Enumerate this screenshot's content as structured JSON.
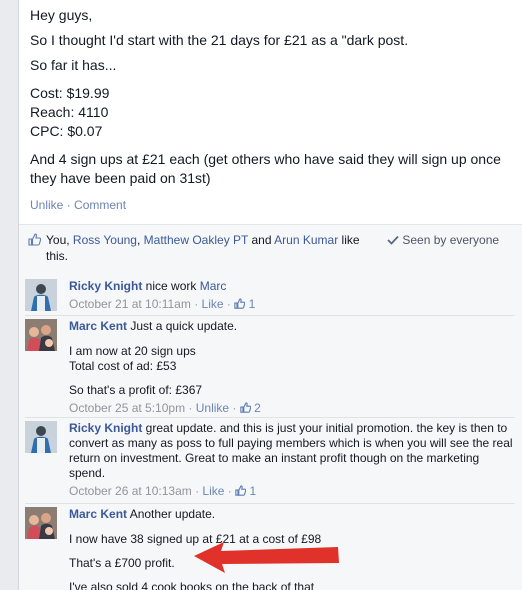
{
  "post": {
    "lines": [
      "Hey guys,",
      "So I thought I'd start with the 21 days for £21 as a \"dark post.",
      "So far it has...",
      "Cost: $19.99",
      "Reach: 4110",
      "CPC: $0.07",
      "And 4 sign ups at £21 each (get others who have said they will sign up once they have been paid on 31st)"
    ]
  },
  "actions": {
    "unlike": "Unlike",
    "separator": "·",
    "comment": "Comment"
  },
  "likes": {
    "you": "You, ",
    "person1": "Ross Young",
    "comma1": ", ",
    "person2": "Matthew Oakley PT",
    "and": " and ",
    "person3": "Arun Kumar",
    "suffix": " like this.",
    "seen_by": "Seen by everyone"
  },
  "comments": [
    {
      "author": "Ricky Knight",
      "text": " nice work ",
      "mention": "Marc",
      "timestamp": "October 21 at 10:11am",
      "like_label": "Like",
      "like_count": "1"
    },
    {
      "author": "Marc Kent",
      "text": " Just a quick update.",
      "para1": "I am now at 20 sign ups",
      "para2": "Total cost of ad: £53",
      "para3": "So that's a profit of: £367",
      "timestamp": "October 25 at 5:10pm",
      "like_label": "Unlike",
      "like_count": "2"
    },
    {
      "author": "Ricky Knight",
      "text": " great update. and this is just your initial promotion. the key is then to convert as many as poss to full paying members which is when you will see the real return on investment. Great to make an instant profit though on the marketing spend.",
      "timestamp": "October 26 at 10:13am",
      "like_label": "Like",
      "like_count": "1"
    },
    {
      "author": "Marc Kent",
      "text": " Another update.",
      "para1": "I now have 38 signed up at £21 at a cost of £98",
      "para2": "That's a £700 profit.",
      "para3": "I've also sold 4 cook books on the back of that"
    }
  ],
  "colors": {
    "link": "#3b5998",
    "arrow": "#e0322b",
    "background": "#f6f7f8"
  },
  "icons": [
    "thumbs-up-icon",
    "checkmark-icon",
    "arrow-icon"
  ]
}
